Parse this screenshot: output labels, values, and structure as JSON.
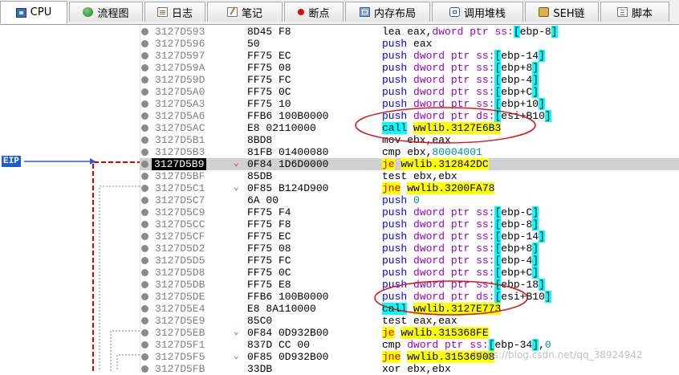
{
  "tabs": [
    {
      "label": "CPU",
      "icon": "cpu-icon",
      "active": true
    },
    {
      "label": "流程图",
      "icon": "flow-graph-icon",
      "active": false
    },
    {
      "label": "日志",
      "icon": "log-icon",
      "active": false
    },
    {
      "label": "笔记",
      "icon": "notes-icon",
      "active": false
    },
    {
      "label": "断点",
      "icon": "breakpoint-icon",
      "active": false
    },
    {
      "label": "内存布局",
      "icon": "memory-map-icon",
      "active": false
    },
    {
      "label": "调用堆栈",
      "icon": "call-stack-icon",
      "active": false
    },
    {
      "label": "SEH链",
      "icon": "seh-chain-icon",
      "active": false
    },
    {
      "label": "脚本",
      "icon": "script-icon",
      "active": false
    }
  ],
  "eip_label": "EIP",
  "disasm": [
    {
      "addr": "3127D593",
      "bytes": "8D45 F8",
      "mn": "lea",
      "ops": "eax,dword ptr ss:[ebp-8]"
    },
    {
      "addr": "3127D596",
      "bytes": "50",
      "mn": "push",
      "ops": "eax"
    },
    {
      "addr": "3127D597",
      "bytes": "FF75 EC",
      "mn": "push",
      "ops": "dword ptr ss:[ebp-14]"
    },
    {
      "addr": "3127D59A",
      "bytes": "FF75 08",
      "mn": "push",
      "ops": "dword ptr ss:[ebp+8]"
    },
    {
      "addr": "3127D59D",
      "bytes": "FF75 FC",
      "mn": "push",
      "ops": "dword ptr ss:[ebp-4]"
    },
    {
      "addr": "3127D5A0",
      "bytes": "FF75 0C",
      "mn": "push",
      "ops": "dword ptr ss:[ebp+C]"
    },
    {
      "addr": "3127D5A3",
      "bytes": "FF75 10",
      "mn": "push",
      "ops": "dword ptr ss:[ebp+10]"
    },
    {
      "addr": "3127D5A6",
      "bytes": "FFB6 100B0000",
      "mn": "push",
      "ops": "dword ptr ds:[esi+B10]"
    },
    {
      "addr": "3127D5AC",
      "bytes": "E8 02110000",
      "mn": "call",
      "ops": "wwlib.3127E6B3"
    },
    {
      "addr": "3127D5B1",
      "bytes": "8BD8",
      "mn": "mov",
      "ops": "ebx,eax"
    },
    {
      "addr": "3127D5B3",
      "bytes": "81FB 01400080",
      "mn": "cmp",
      "ops": "ebx,80004001"
    },
    {
      "addr": "3127D5B9",
      "bytes": "0F84 1D6D0000",
      "mn": "je",
      "ops": "wwlib.312842DC"
    },
    {
      "addr": "3127D5BF",
      "bytes": "85DB",
      "mn": "test",
      "ops": "ebx,ebx"
    },
    {
      "addr": "3127D5C1",
      "bytes": "0F85 B124D900",
      "mn": "jne",
      "ops": "wwlib.3200FA78"
    },
    {
      "addr": "3127D5C7",
      "bytes": "6A 00",
      "mn": "push",
      "ops": "0"
    },
    {
      "addr": "3127D5C9",
      "bytes": "FF75 F4",
      "mn": "push",
      "ops": "dword ptr ss:[ebp-C]"
    },
    {
      "addr": "3127D5CC",
      "bytes": "FF75 F8",
      "mn": "push",
      "ops": "dword ptr ss:[ebp-8]"
    },
    {
      "addr": "3127D5CF",
      "bytes": "FF75 EC",
      "mn": "push",
      "ops": "dword ptr ss:[ebp-14]"
    },
    {
      "addr": "3127D5D2",
      "bytes": "FF75 08",
      "mn": "push",
      "ops": "dword ptr ss:[ebp+8]"
    },
    {
      "addr": "3127D5D5",
      "bytes": "FF75 FC",
      "mn": "push",
      "ops": "dword ptr ss:[ebp-4]"
    },
    {
      "addr": "3127D5D8",
      "bytes": "FF75 0C",
      "mn": "push",
      "ops": "dword ptr ss:[ebp+C]"
    },
    {
      "addr": "3127D5DB",
      "bytes": "FF75 E8",
      "mn": "push",
      "ops": "dword ptr ss:[ebp-18]"
    },
    {
      "addr": "3127D5DE",
      "bytes": "FFB6 100B0000",
      "mn": "push",
      "ops": "dword ptr ds:[esi+B10]"
    },
    {
      "addr": "3127D5E4",
      "bytes": "E8 8A110000",
      "mn": "call",
      "ops": "wwlib.3127E773"
    },
    {
      "addr": "3127D5E9",
      "bytes": "85C0",
      "mn": "test",
      "ops": "eax,eax"
    },
    {
      "addr": "3127D5EB",
      "bytes": "0F84 0D932B00",
      "mn": "je",
      "ops": "wwlib.315368FE"
    },
    {
      "addr": "3127D5F1",
      "bytes": "837D CC 00",
      "mn": "cmp",
      "ops": "dword ptr ss:[ebp-34],0"
    },
    {
      "addr": "3127D5F5",
      "bytes": "0F85 0D932B00",
      "mn": "jne",
      "ops": "wwlib.31536908"
    },
    {
      "addr": "3127D5FB",
      "bytes": "33DB",
      "mn": "xor",
      "ops": "ebx,ebx"
    }
  ],
  "watermark": "https://blog.csdn.net/qq_38924942"
}
